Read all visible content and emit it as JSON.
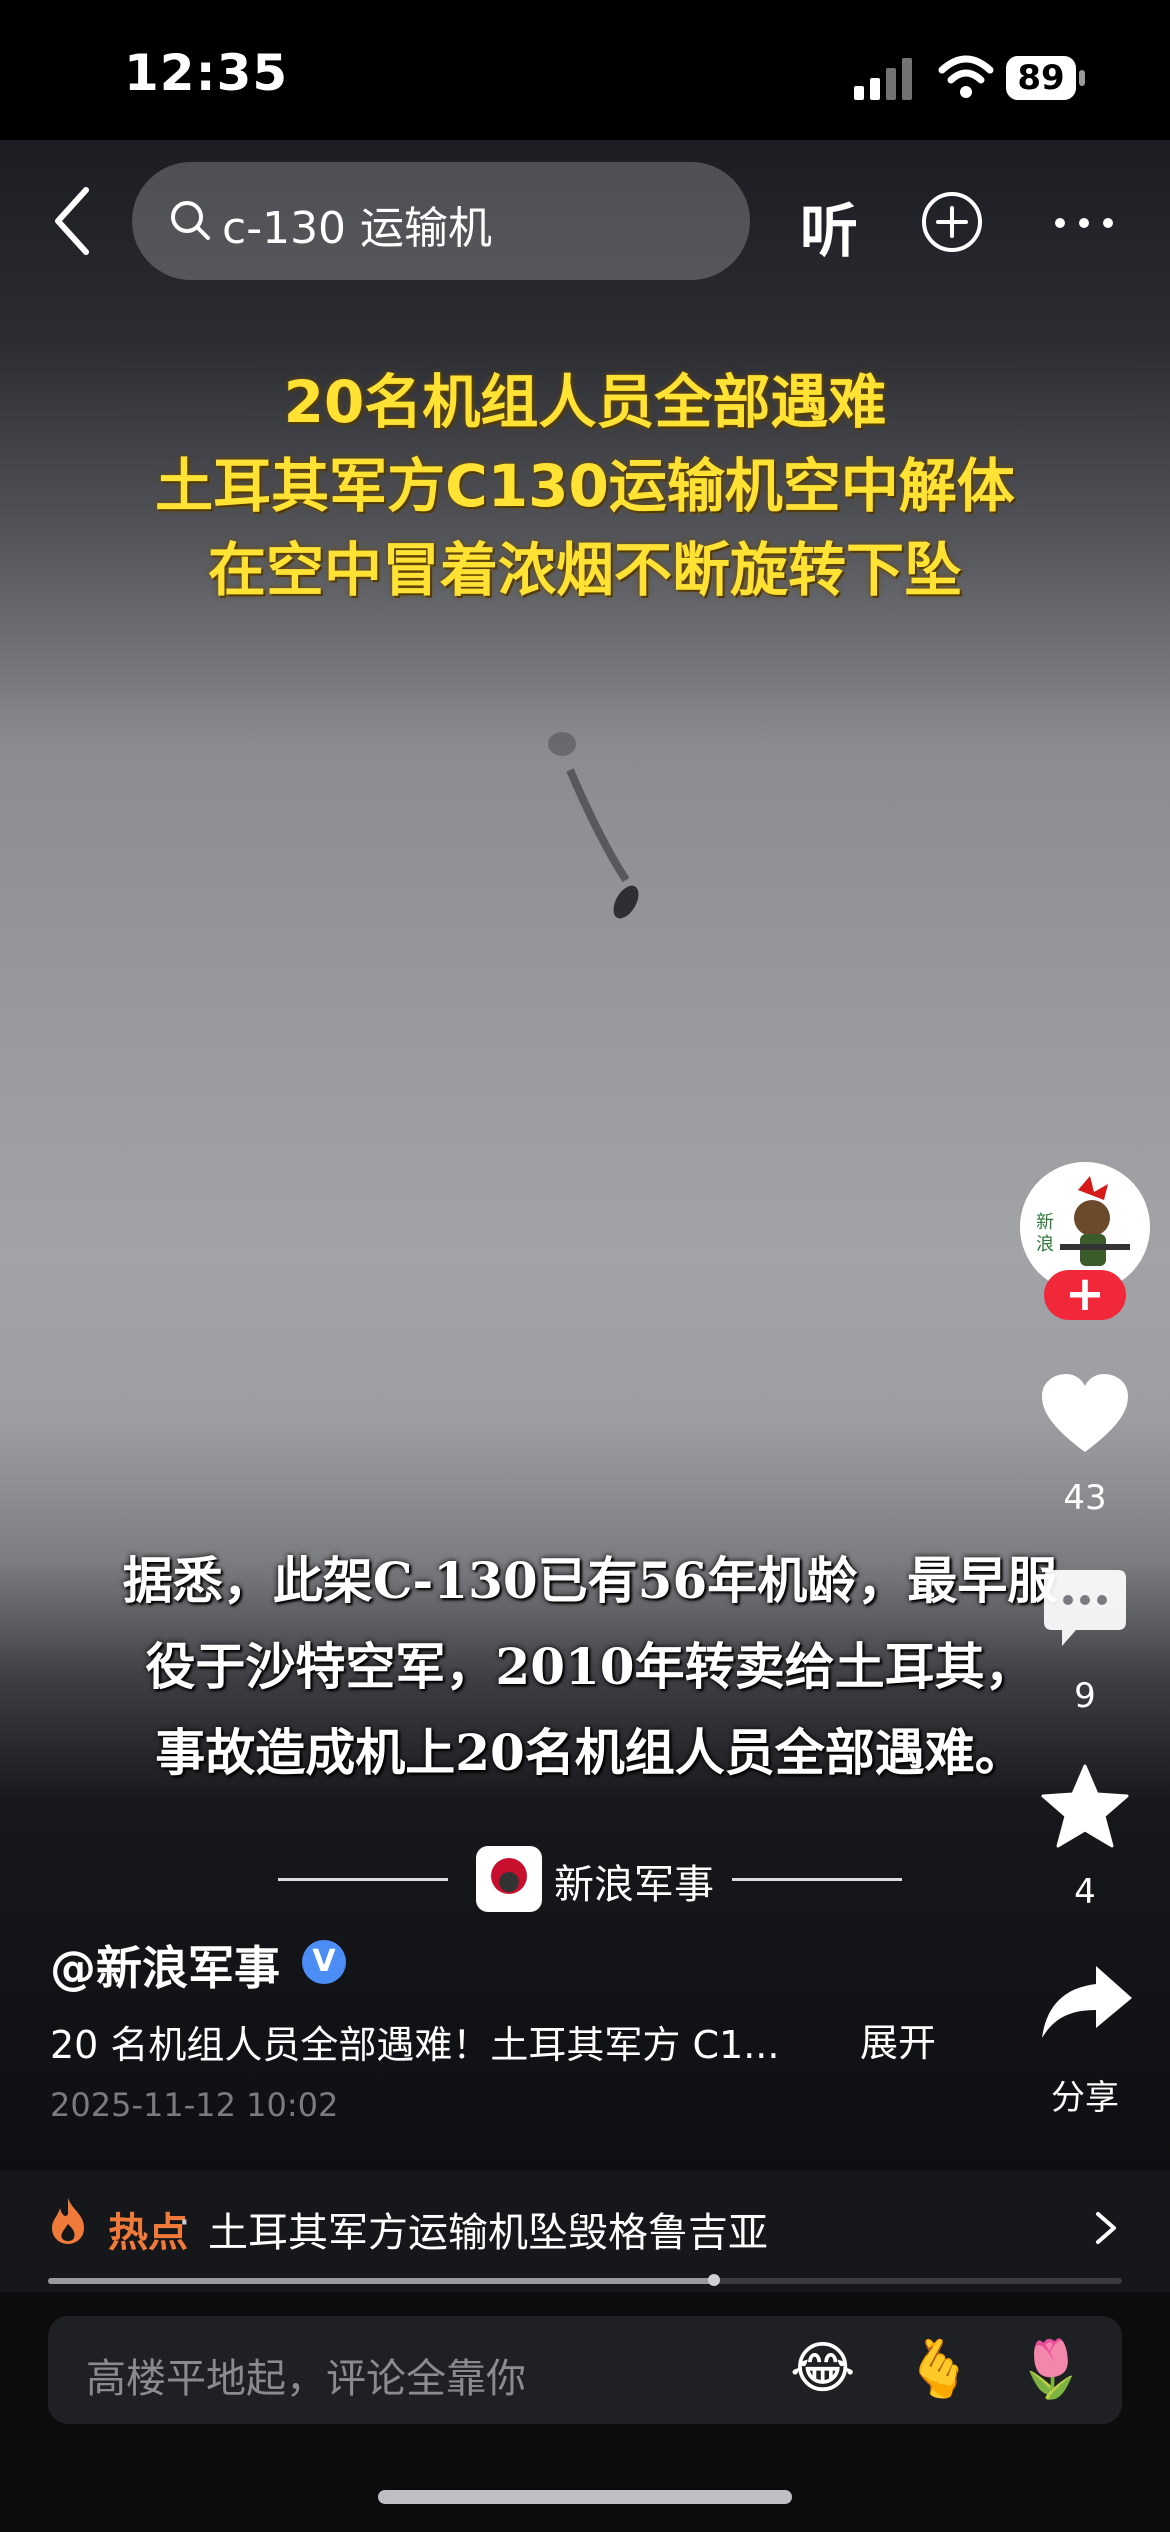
{
  "status_bar": {
    "time": "12:35",
    "battery": "89"
  },
  "search": {
    "query": "c-130 运输机"
  },
  "header": {
    "listen_label": "听"
  },
  "video": {
    "headline_lines": [
      "20名机组人员全部遇难",
      "土耳其军方C130运输机空中解体",
      "在空中冒着浓烟不断旋转下坠"
    ],
    "subtitle_lines": [
      "据悉，此架C-130已有56年机龄，最早服",
      "役于沙特空军，2010年转卖给土耳其，",
      "事故造成机上20名机组人员全部遇难。"
    ],
    "watermark_text": "新浪军事"
  },
  "actions": {
    "like_count": "43",
    "comment_count": "9",
    "favorite_count": "4",
    "share_label": "分享",
    "follow_symbol": "+"
  },
  "author": {
    "handle": "@新浪军事",
    "verified_symbol": "V",
    "description": "20 名机组人员全部遇难！土耳其军方 C1...",
    "expand_label": "展开",
    "date": "2025-11-12 10:02"
  },
  "hot": {
    "label": "热点",
    "separator": "·",
    "text": "土耳其军方运输机坠毁格鲁吉亚",
    "progress": 0.62
  },
  "comment_bar": {
    "placeholder": "高楼平地起，评论全靠你",
    "emojis": [
      "😂",
      "🫰",
      "🌷"
    ]
  },
  "colors": {
    "headline": "#ffe234",
    "hot": "#f07a3a",
    "follow": "#f0283a",
    "verify": "#4b8cf5"
  }
}
